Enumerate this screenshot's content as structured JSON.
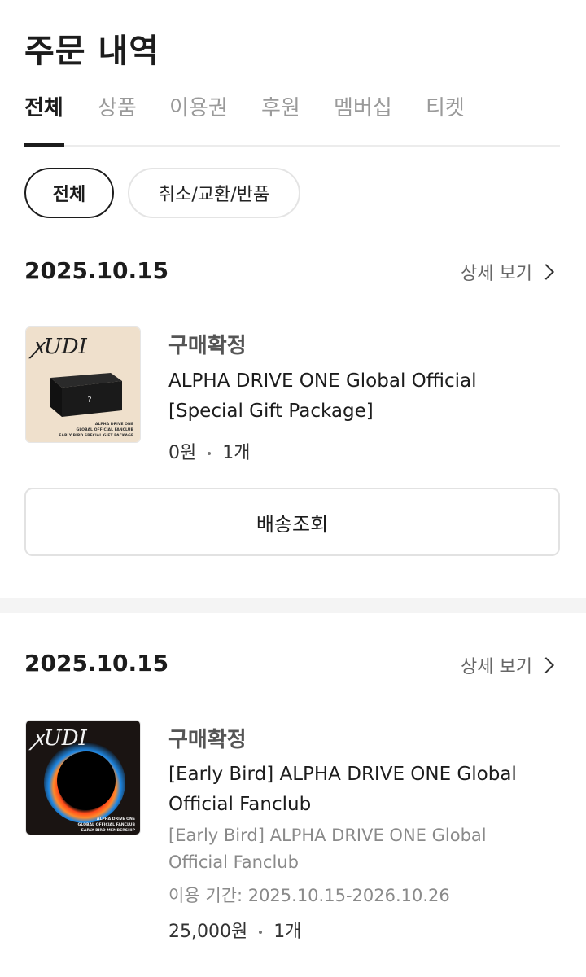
{
  "header": {
    "title": "주문 내역"
  },
  "tabs": [
    {
      "label": "전체",
      "active": true
    },
    {
      "label": "상품"
    },
    {
      "label": "이용권"
    },
    {
      "label": "후원"
    },
    {
      "label": "멤버십"
    },
    {
      "label": "티켓"
    }
  ],
  "filters": [
    {
      "label": "전체",
      "active": true
    },
    {
      "label": "취소/교환/반품"
    }
  ],
  "orders": [
    {
      "date": "2025.10.15",
      "detail_label": "상세 보기",
      "thumb_logo": "ꭗUDI",
      "thumb_mark": "?",
      "thumb_caption": [
        "ALPHA DRIVE ONE",
        "GLOBAL OFFICIAL FANCLUB",
        "EARLY BIRD SPECIAL GIFT PACKAGE"
      ],
      "status": "구매확정",
      "name": "ALPHA DRIVE ONE Global Official [Special Gift Package]",
      "price": "0원",
      "qty": "1개",
      "button_label": "배송조회"
    },
    {
      "date": "2025.10.15",
      "detail_label": "상세 보기",
      "thumb_logo": "ꭗUDI",
      "thumb_caption": [
        "ALPHA DRIVE ONE",
        "GLOBAL OFFICIAL FANCLUB",
        "EARLY BIRD MEMBERSHIP"
      ],
      "status": "구매확정",
      "name": "[Early Bird] ALPHA DRIVE ONE Global Official Fanclub",
      "subname": "[Early Bird] ALPHA DRIVE ONE Global Official Fanclub",
      "period": "이용 기간: 2025.10.15-2026.10.26",
      "price": "25,000원",
      "qty": "1개"
    }
  ],
  "colors": {
    "text": "#1c1c1c",
    "muted": "#8a8a8a",
    "tab_inactive": "#9a9a9a",
    "divider": "#ececec"
  }
}
